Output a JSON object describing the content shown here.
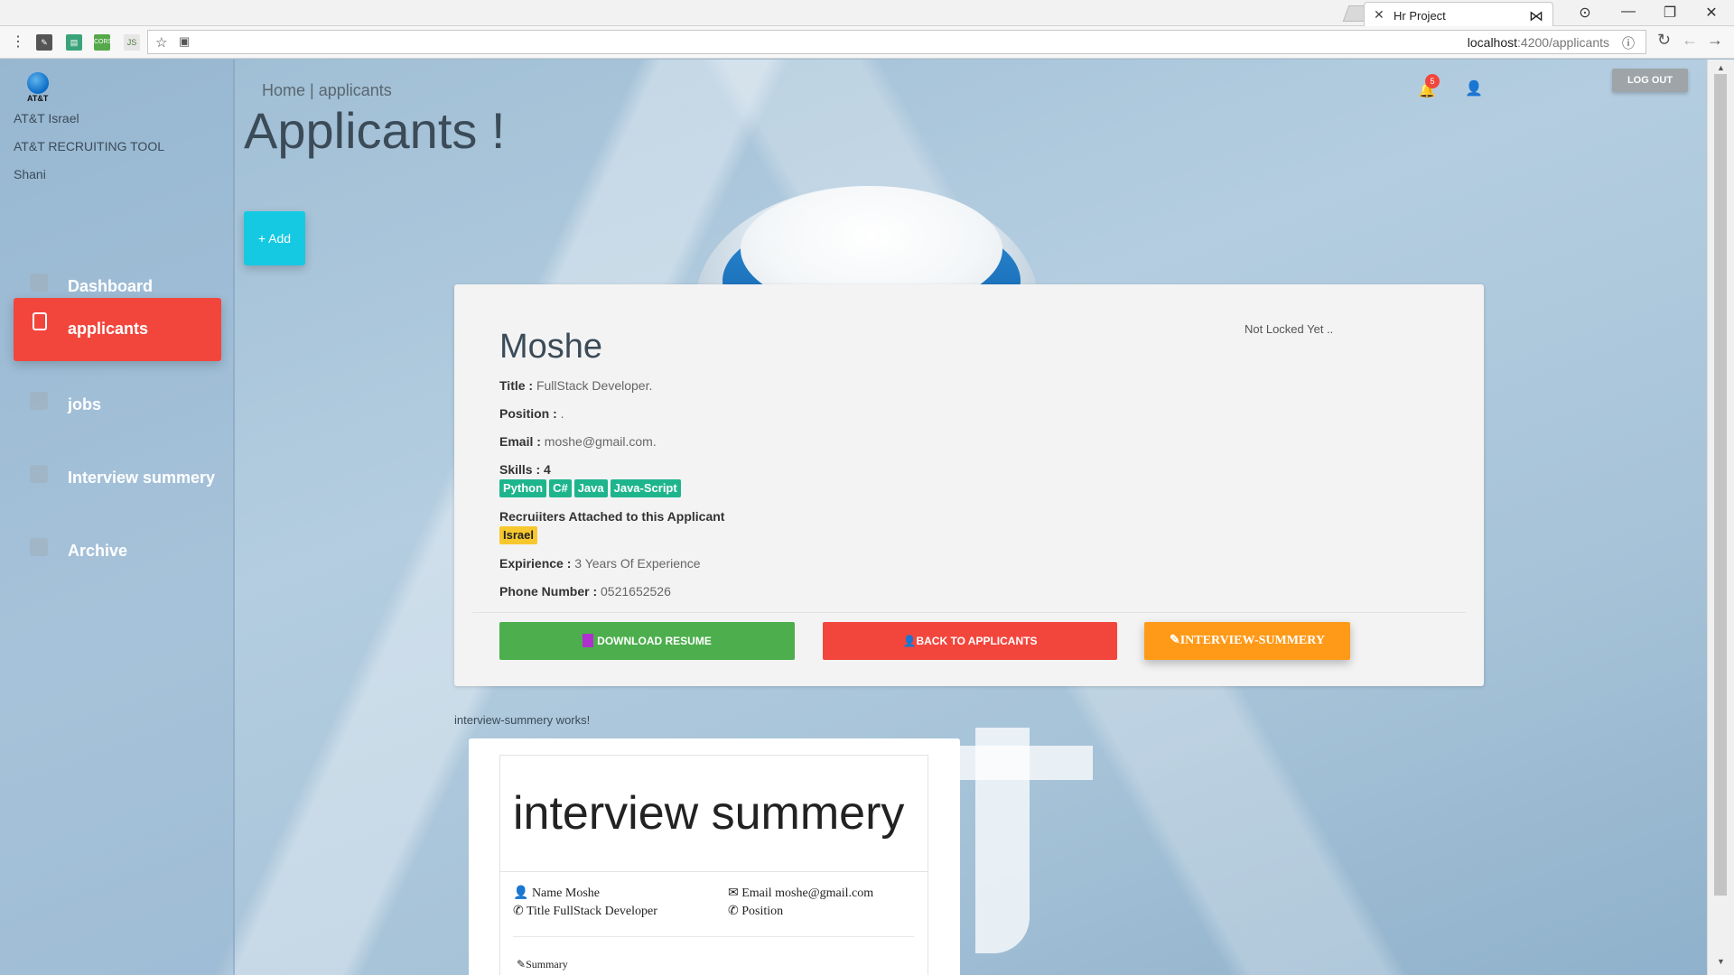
{
  "browser": {
    "tab_title": "Hr Project",
    "tab_close": "✕",
    "url_host": "localhost",
    "url_path": ":4200/applicants",
    "controls": {
      "profile": "⊙",
      "minimize": "—",
      "maximize": "❐",
      "close": "✕"
    },
    "extensions": {
      "e3": "CORS",
      "e4": "JS"
    }
  },
  "sidebar": {
    "logo_text": "AT&T",
    "company": "AT&T Israel",
    "tool": "AT&T RECRUITING TOOL",
    "user": "Shani",
    "items": [
      {
        "label": "Dashboard",
        "icon": "dashboard-icon"
      },
      {
        "label": "applicants",
        "icon": "clipboard-icon",
        "active": true
      },
      {
        "label": "jobs",
        "icon": "list-icon"
      },
      {
        "label": "Interview summery",
        "icon": "person-icon"
      },
      {
        "label": "Archive",
        "icon": "folder-icon"
      }
    ]
  },
  "header": {
    "breadcrumb": "Home | applicants",
    "title": "Applicants !",
    "notification_count": "5",
    "logout": "LOG OUT",
    "add": "+ Add"
  },
  "applicant": {
    "name": "Moshe",
    "lock_status": "Not Locked Yet ..",
    "title_key": "Title :",
    "title_val": " FullStack Developer.",
    "position_key": "Position :",
    "position_val": " .",
    "email_key": "Email :",
    "email_val": " moshe@gmail.com.",
    "skills_key": "Skills : 4",
    "skills": [
      "Python",
      "C#",
      "Java",
      "Java-Script"
    ],
    "recruiters_label": "Recruiiters Attached to this Applicant",
    "recruiters": [
      "Israel"
    ],
    "exp_key": "Expirience :",
    "exp_val": " 3 Years Of Experience",
    "phone_key": "Phone Number :",
    "phone_val": " 0521652526",
    "buttons": {
      "download": "DOWNLOAD RESUME",
      "back": "BACK TO APPLICANTS",
      "interview": "INTERVIEW-SUMMERY"
    }
  },
  "interview": {
    "works_text": "interview-summery works!",
    "heading": "interview summery",
    "name": "Name Moshe",
    "title": "Title FullStack Developer",
    "email": "Email moshe@gmail.com",
    "position": "Position",
    "summary": "Summary"
  },
  "colors": {
    "active_nav": "#f2463d",
    "add_button": "#15c9e3",
    "download_button": "#4cae4c",
    "back_button": "#f2463d",
    "interview_button": "#ff9a19",
    "skill_badge": "#1eb58d",
    "recruiter_badge": "#f7c82e"
  }
}
